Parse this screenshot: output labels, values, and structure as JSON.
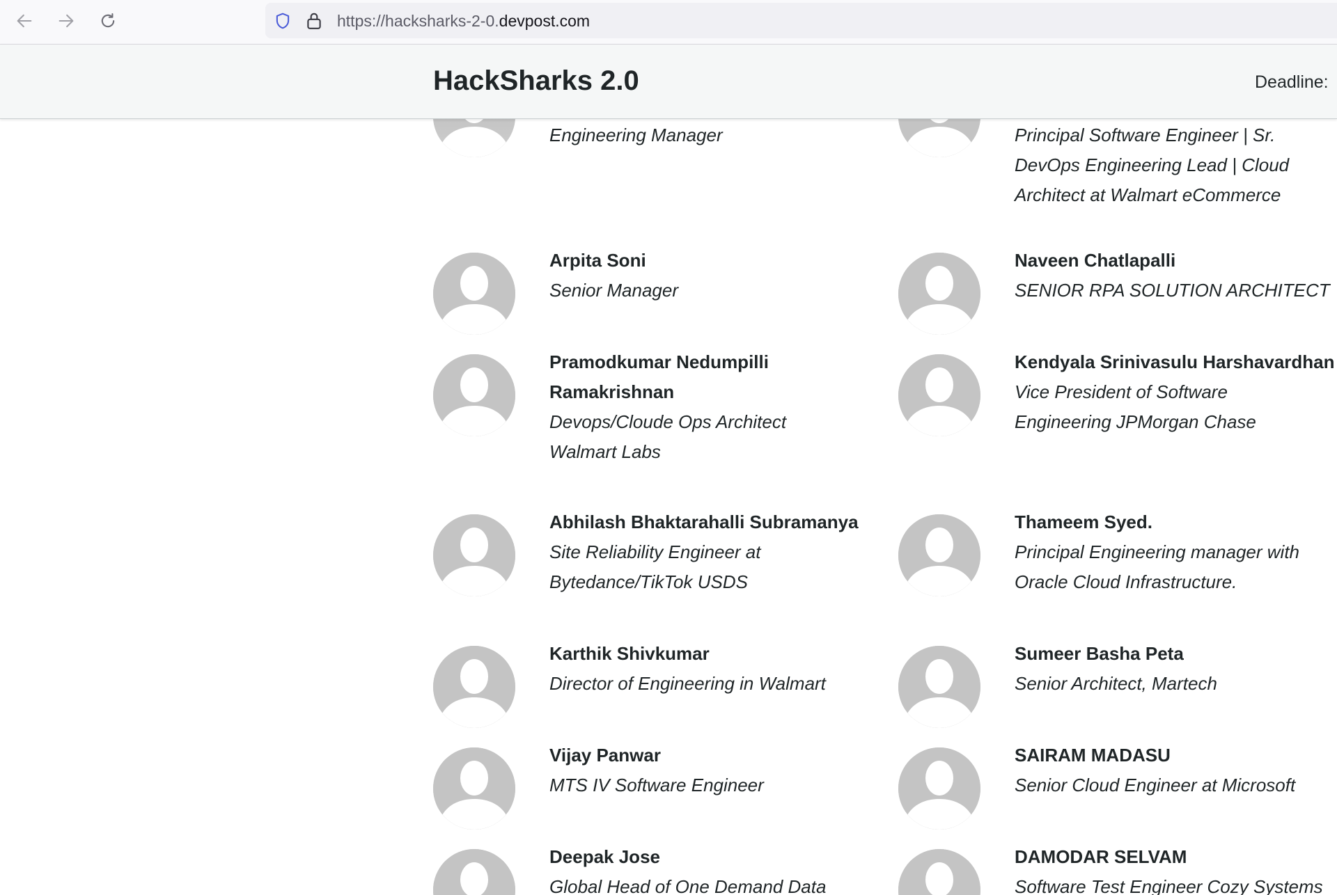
{
  "browser": {
    "url_prefix": "https://hacksharks-2-0.",
    "url_domain": "devpost.com"
  },
  "header": {
    "title": "HackSharks 2.0",
    "deadline_label": "Deadline:"
  },
  "judges": [
    {
      "name": "",
      "role": "Engineering Manager"
    },
    {
      "name": "",
      "role": "Principal Software Engineer | Sr. DevOps Engineering Lead | Cloud Architect at Walmart eCommerce"
    },
    {
      "name": "Arpita Soni",
      "role": "Senior Manager"
    },
    {
      "name": "Naveen Chatlapalli",
      "role": "SENIOR RPA SOLUTION ARCHITECT"
    },
    {
      "name": "Pramodkumar Nedumpilli Ramakrishnan",
      "role": "Devops/Cloude Ops Architect Walmart Labs"
    },
    {
      "name": "Kendyala Srinivasulu Harshavardhan",
      "role": "Vice President of Software Engineering JPMorgan Chase"
    },
    {
      "name": "Abhilash Bhaktarahalli Subramanya",
      "role": "Site Reliability Engineer at Bytedance/TikTok USDS"
    },
    {
      "name": "Thameem Syed.",
      "role": "Principal Engineering manager with Oracle Cloud Infrastructure."
    },
    {
      "name": "Karthik Shivkumar",
      "role": "Director of Engineering in Walmart"
    },
    {
      "name": "Sumeer Basha Peta",
      "role": "Senior Architect, Martech"
    },
    {
      "name": "Vijay Panwar",
      "role": "MTS IV Software Engineer"
    },
    {
      "name": "SAIRAM MADASU",
      "role": "Senior Cloud Engineer at Microsoft"
    },
    {
      "name": "Deepak Jose",
      "role": "Global Head of One Demand Data"
    },
    {
      "name": "DAMODAR SELVAM",
      "role": "Software Test Engineer Cozy Systems"
    }
  ]
}
